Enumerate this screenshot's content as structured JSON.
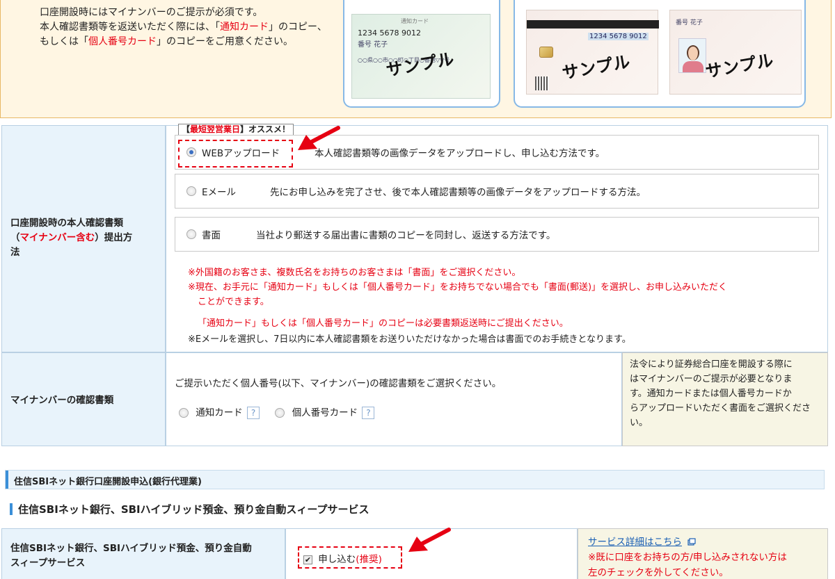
{
  "notice": {
    "line1": "口座開設時にはマイナンバーのご提示が必須です。",
    "line2_a": "本人確認書類等を返送いただく際には、「",
    "line2_b": "通知カード",
    "line2_c": "」のコピー、",
    "line3_a": "もしくは「",
    "line3_b": "個人番号カード",
    "line3_c": "」のコピーをご用意ください。"
  },
  "cards": {
    "notification": {
      "header": "通知カード",
      "number": "1234 5678 9012",
      "name": "番号 花子",
      "address": "○○県○○市○○町○丁目○番地▽▽号",
      "sample": "サンプル"
    },
    "my_number_back": {
      "number": "1234 5678 9012",
      "sample": "サンプル"
    },
    "my_number_front": {
      "name": "番号 花子",
      "sample": "サンプル"
    }
  },
  "submission": {
    "label_a": "口座開設時の本人確認書類",
    "label_b": "（",
    "label_c": "マイナンバー含む",
    "label_d": "）提出方",
    "label_e": "法",
    "badge_a": "【",
    "badge_b": "最短翌営業日",
    "badge_c": "】オススメ！",
    "options": [
      {
        "label": "WEBアップロード",
        "description": "本人確認書類等の画像データをアップロードし、申し込む方法です。",
        "selected": true
      },
      {
        "label": "Eメール",
        "description": "先にお申し込みを完了させ、後で本人確認書類等の画像データをアップロードする方法。",
        "selected": false
      },
      {
        "label": "書面",
        "description": "当社より郵送する届出書に書類のコピーを同封し、返送する方法です。",
        "selected": false
      }
    ],
    "notes": [
      "※外国籍のお客さま、複数氏名をお持ちのお客さまは「書面」をご選択ください。",
      "※現在、お手元に「通知カード」もしくは「個人番号カード」をお持ちでない場合でも「書面(郵送)」を選択し、お申し込みいただく",
      "ことができます。",
      "「通知カード」もしくは「個人番号カード」のコピーは必要書類返送時にご提出ください。",
      "※Eメールを選択し、7日以内に本人確認書類をお送りいただけなかった場合は書面でのお手続きとなります。"
    ]
  },
  "mynumber_doc": {
    "label": "マイナンバーの確認書類",
    "prompt": "ご提示いただく個人番号(以下、マイナンバー)の確認書類をご選択ください。",
    "options": [
      {
        "label": "通知カード"
      },
      {
        "label": "個人番号カード"
      }
    ],
    "help_glyph": "?",
    "side_note": [
      "法令により証券総合口座を開設する際に",
      "はマイナンバーのご提示が必要となりま",
      "す。通知カードまたは個人番号カードか",
      "らアップロードいただく書面をご選択くださ",
      "い。"
    ]
  },
  "bank_section": {
    "bar_title": "住信SBIネット銀行口座開設申込(銀行代理業)",
    "subtitle": "住信SBIネット銀行、SBIハイブリッド預金、預り金自動スィープサービス",
    "row_label_1": "住信SBIネット銀行、SBIハイブリッド預金、預り金自動",
    "row_label_2": "スィープサービス",
    "checkbox_label_a": "申し込む",
    "checkbox_label_b": "(推奨)",
    "check_glyph": "✔",
    "detail_link": "サービス詳細はこちら",
    "note_1": "※既に口座をお持ちの方/申し込みされない方は",
    "note_2": "左のチェックを外してください。"
  },
  "colors": {
    "accent_red": "#e60012",
    "label_bg": "#e8f3fb",
    "notice_bg": "#fff6e3"
  }
}
